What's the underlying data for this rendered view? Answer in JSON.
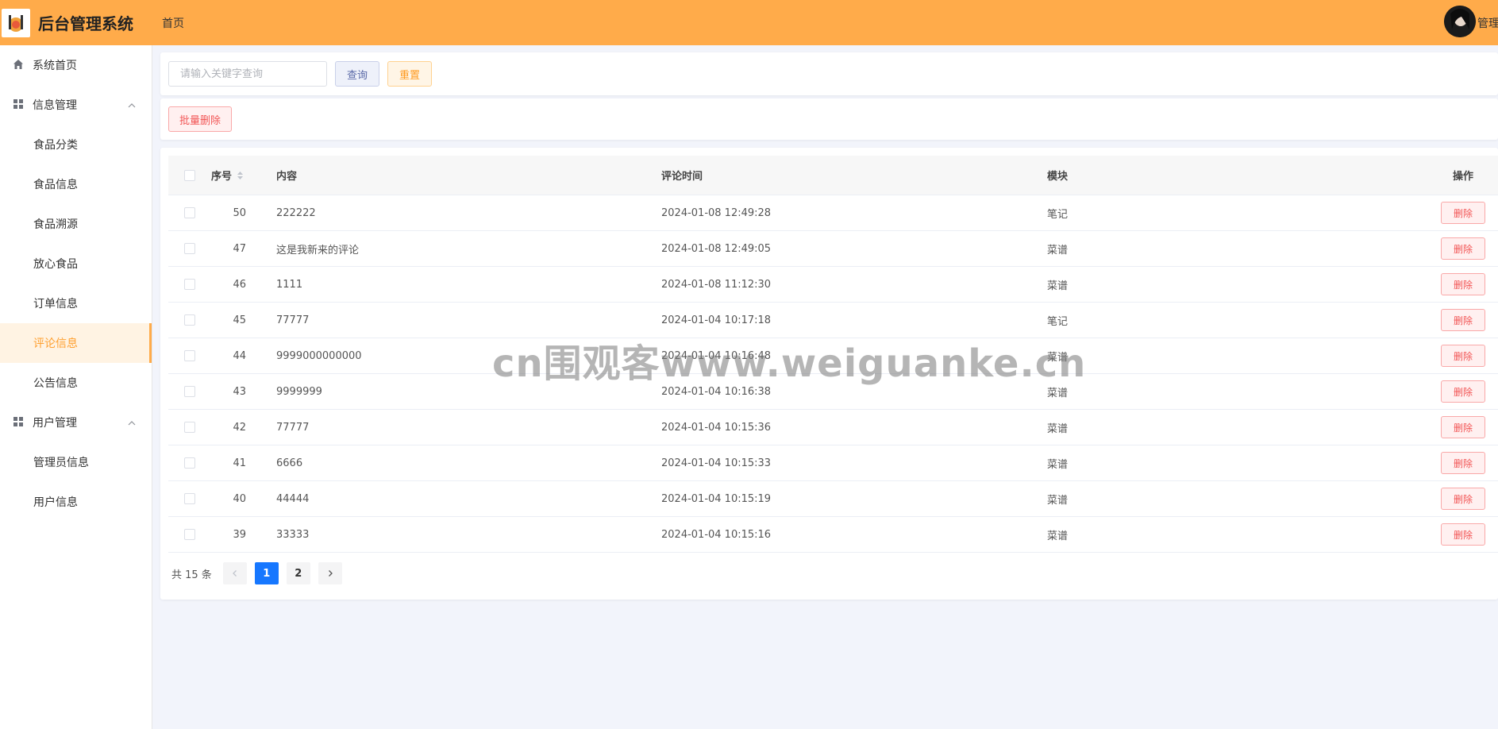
{
  "header": {
    "app_title": "后台管理系统",
    "nav_home": "首页",
    "user_name": "管理员",
    "bg_color": "#ffab4a"
  },
  "sidebar": {
    "items": [
      {
        "label": "系统首页",
        "icon": "home-icon",
        "type": "top"
      },
      {
        "label": "信息管理",
        "icon": "grid-icon",
        "type": "group",
        "expanded": true
      },
      {
        "label": "食品分类",
        "type": "sub"
      },
      {
        "label": "食品信息",
        "type": "sub"
      },
      {
        "label": "食品溯源",
        "type": "sub"
      },
      {
        "label": "放心食品",
        "type": "sub"
      },
      {
        "label": "订单信息",
        "type": "sub"
      },
      {
        "label": "评论信息",
        "type": "sub",
        "active": true
      },
      {
        "label": "公告信息",
        "type": "sub"
      },
      {
        "label": "用户管理",
        "icon": "grid-icon",
        "type": "group",
        "expanded": true
      },
      {
        "label": "管理员信息",
        "type": "sub"
      },
      {
        "label": "用户信息",
        "type": "sub"
      }
    ]
  },
  "search": {
    "placeholder": "请输入关键字查询",
    "query_label": "查询",
    "reset_label": "重置"
  },
  "actions": {
    "batch_delete_label": "批量删除"
  },
  "table": {
    "columns": {
      "id": "序号",
      "content": "内容",
      "time": "评论时间",
      "module": "模块",
      "op": "操作"
    },
    "delete_label": "删除",
    "rows": [
      {
        "id": "50",
        "content": "222222",
        "time": "2024-01-08 12:49:28",
        "module": "笔记"
      },
      {
        "id": "47",
        "content": "这是我新来的评论",
        "time": "2024-01-08 12:49:05",
        "module": "菜谱"
      },
      {
        "id": "46",
        "content": "1111",
        "time": "2024-01-08 11:12:30",
        "module": "菜谱"
      },
      {
        "id": "45",
        "content": "77777",
        "time": "2024-01-04 10:17:18",
        "module": "笔记"
      },
      {
        "id": "44",
        "content": "9999000000000",
        "time": "2024-01-04 10:16:48",
        "module": "菜谱"
      },
      {
        "id": "43",
        "content": "9999999",
        "time": "2024-01-04 10:16:38",
        "module": "菜谱"
      },
      {
        "id": "42",
        "content": "77777",
        "time": "2024-01-04 10:15:36",
        "module": "菜谱"
      },
      {
        "id": "41",
        "content": "6666",
        "time": "2024-01-04 10:15:33",
        "module": "菜谱"
      },
      {
        "id": "40",
        "content": "44444",
        "time": "2024-01-04 10:15:19",
        "module": "菜谱"
      },
      {
        "id": "39",
        "content": "33333",
        "time": "2024-01-04 10:15:16",
        "module": "菜谱"
      }
    ]
  },
  "pagination": {
    "total_text": "共 15 条",
    "pages": [
      "1",
      "2"
    ],
    "current": "1"
  },
  "watermark": "cn围观客www.weiguanke.cn"
}
